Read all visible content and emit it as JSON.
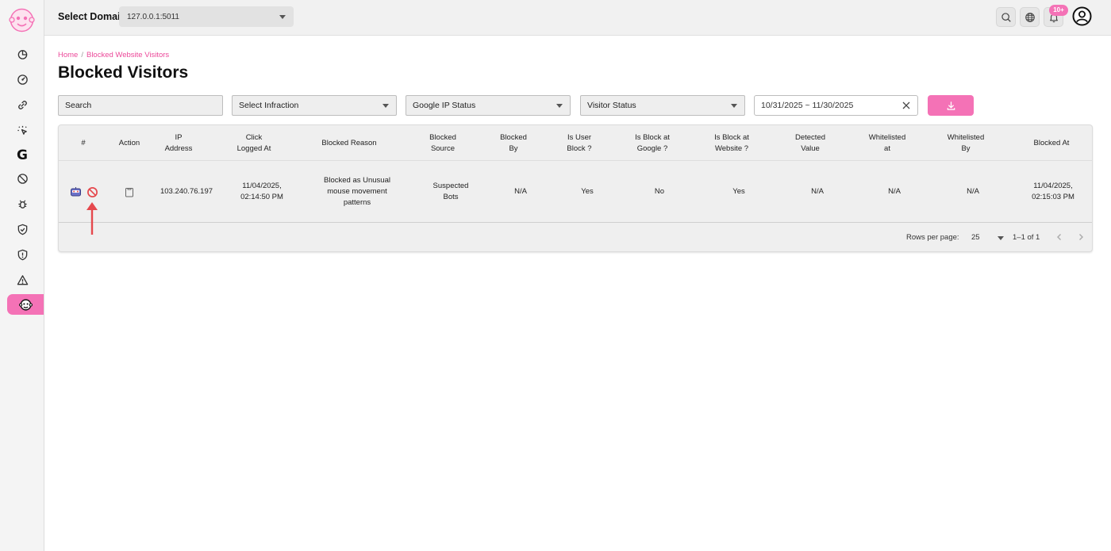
{
  "colors": {
    "accent": "#f472b6",
    "danger": "#e5484d"
  },
  "topbar": {
    "domain_label": "Select Domain",
    "domain_value": "127.0.0.1:5011",
    "notification_badge": "10+"
  },
  "sidebar": {
    "items": [
      {
        "icon": "pie-chart-icon"
      },
      {
        "icon": "gauge-icon"
      },
      {
        "icon": "link-icon"
      },
      {
        "icon": "click-icon"
      },
      {
        "icon": "google-icon",
        "label": "G"
      },
      {
        "icon": "block-icon"
      },
      {
        "icon": "bug-icon"
      },
      {
        "icon": "shield-check-icon"
      },
      {
        "icon": "shield-alert-icon"
      },
      {
        "icon": "warning-icon"
      },
      {
        "icon": "monkey-icon",
        "active": true
      }
    ]
  },
  "breadcrumb": {
    "home": "Home",
    "separator": "/",
    "current": "Blocked Website Visitors"
  },
  "page_title": "Blocked Visitors",
  "filters": {
    "search_placeholder": "Search",
    "infraction": "Select Infraction",
    "google_ip_status": "Google IP Status",
    "visitor_status": "Visitor Status",
    "date_range": "10/31/2025 ~ 11/30/2025"
  },
  "table": {
    "headers": {
      "index": "#",
      "action": "Action",
      "ip_1": "IP",
      "ip_2": "Address",
      "click_1": "Click",
      "click_2": "Logged At",
      "reason": "Blocked Reason",
      "source_1": "Blocked",
      "source_2": "Source",
      "by_1": "Blocked",
      "by_2": "By",
      "user_block_1": "Is User",
      "user_block_2": "Block ?",
      "google_block_1": "Is Block at",
      "google_block_2": "Google ?",
      "website_block_1": "Is Block at",
      "website_block_2": "Website ?",
      "detected_1": "Detected",
      "detected_2": "Value",
      "wl_at_1": "Whitelisted",
      "wl_at_2": "at",
      "wl_by_1": "Whitelisted",
      "wl_by_2": "By",
      "blocked_at": "Blocked At"
    },
    "rows": [
      {
        "ip": "103.240.76.197",
        "click_1": "11/04/2025,",
        "click_2": "02:14:50 PM",
        "reason_1": "Blocked as Unusual",
        "reason_2": "mouse movement",
        "reason_3": "patterns",
        "source_1": "Suspected",
        "source_2": "Bots",
        "by": "N/A",
        "user_block": "Yes",
        "google_block": "No",
        "website_block": "Yes",
        "detected": "N/A",
        "wl_at": "N/A",
        "wl_by": "N/A",
        "blocked_at_1": "11/04/2025,",
        "blocked_at_2": "02:15:03 PM"
      }
    ]
  },
  "pagination": {
    "rows_per_page_label": "Rows per page:",
    "rows_per_page": "25",
    "range": "1–1 of 1"
  }
}
